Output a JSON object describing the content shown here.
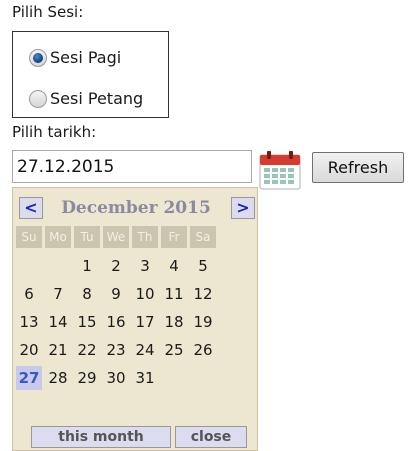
{
  "session": {
    "label": "Pilih Sesi:",
    "options": [
      {
        "label": "Sesi Pagi",
        "checked": true
      },
      {
        "label": "Sesi Petang",
        "checked": false
      }
    ]
  },
  "date": {
    "label": "Pilih tarikh:",
    "value": "27.12.2015",
    "refresh_label": "Refresh",
    "calendar_icon": "calendar-icon"
  },
  "calendar": {
    "prev_label": "<",
    "next_label": ">",
    "month_title": "December 2015",
    "weekdays": [
      "Su",
      "Mo",
      "Tu",
      "We",
      "Th",
      "Fr",
      "Sa"
    ],
    "weeks": [
      [
        "",
        "",
        "1",
        "2",
        "3",
        "4",
        "5"
      ],
      [
        "6",
        "7",
        "8",
        "9",
        "10",
        "11",
        "12"
      ],
      [
        "13",
        "14",
        "15",
        "16",
        "17",
        "18",
        "19"
      ],
      [
        "20",
        "21",
        "22",
        "23",
        "24",
        "25",
        "26"
      ],
      [
        "27",
        "28",
        "29",
        "30",
        "31",
        "",
        ""
      ]
    ],
    "selected_day": "27",
    "this_month_label": "this month",
    "close_label": "close"
  }
}
